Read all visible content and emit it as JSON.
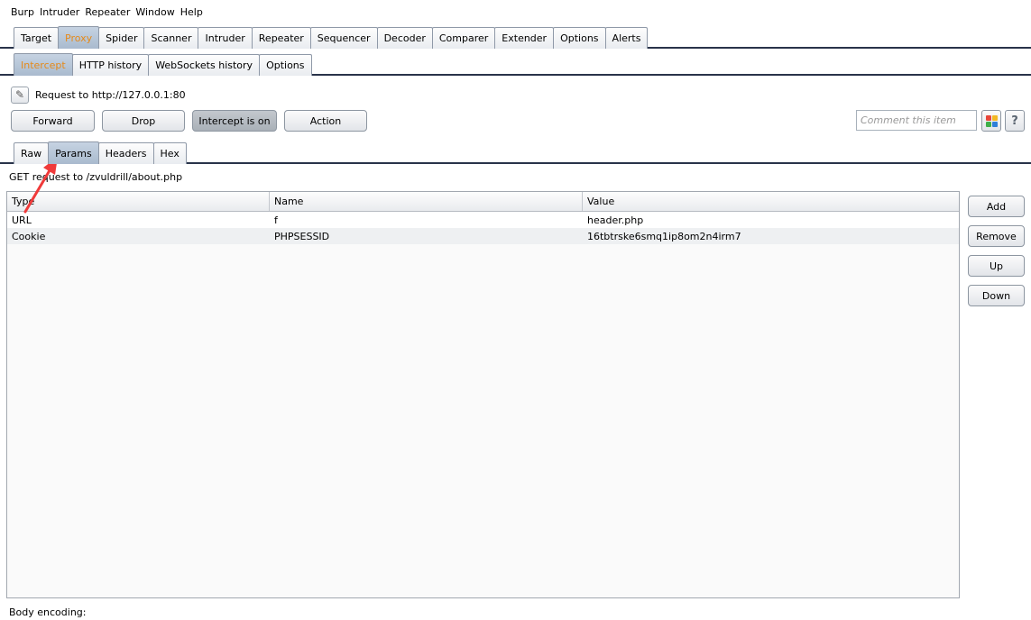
{
  "menu": [
    "Burp",
    "Intruder",
    "Repeater",
    "Window",
    "Help"
  ],
  "main_tabs": [
    "Target",
    "Proxy",
    "Spider",
    "Scanner",
    "Intruder",
    "Repeater",
    "Sequencer",
    "Decoder",
    "Comparer",
    "Extender",
    "Options",
    "Alerts"
  ],
  "sub_tabs": [
    "Intercept",
    "HTTP history",
    "WebSockets history",
    "Options"
  ],
  "request_to": "Request to http://127.0.0.1:80",
  "actions": {
    "forward": "Forward",
    "drop": "Drop",
    "intercept": "Intercept is on",
    "action": "Action"
  },
  "comment_placeholder": "Comment this item",
  "help_label": "?",
  "message_tabs": [
    "Raw",
    "Params",
    "Headers",
    "Hex"
  ],
  "get_line": "GET request to /zvuldrill/about.php",
  "table": {
    "headers": [
      "Type",
      "Name",
      "Value"
    ],
    "rows": [
      [
        "URL",
        "f",
        "header.php"
      ],
      [
        "Cookie",
        "PHPSESSID",
        "16tbtrske6smq1ip8om2n4irm7"
      ]
    ]
  },
  "side_buttons": [
    "Add",
    "Remove",
    "Up",
    "Down"
  ],
  "body_encoding": "Body encoding:",
  "colors": {
    "active_tab_text": "#e58a1b",
    "annotation_arrow": "#f03a3a",
    "grid_colors": [
      "#e8463a",
      "#f2b824",
      "#3fae49",
      "#2f7fd8"
    ]
  }
}
